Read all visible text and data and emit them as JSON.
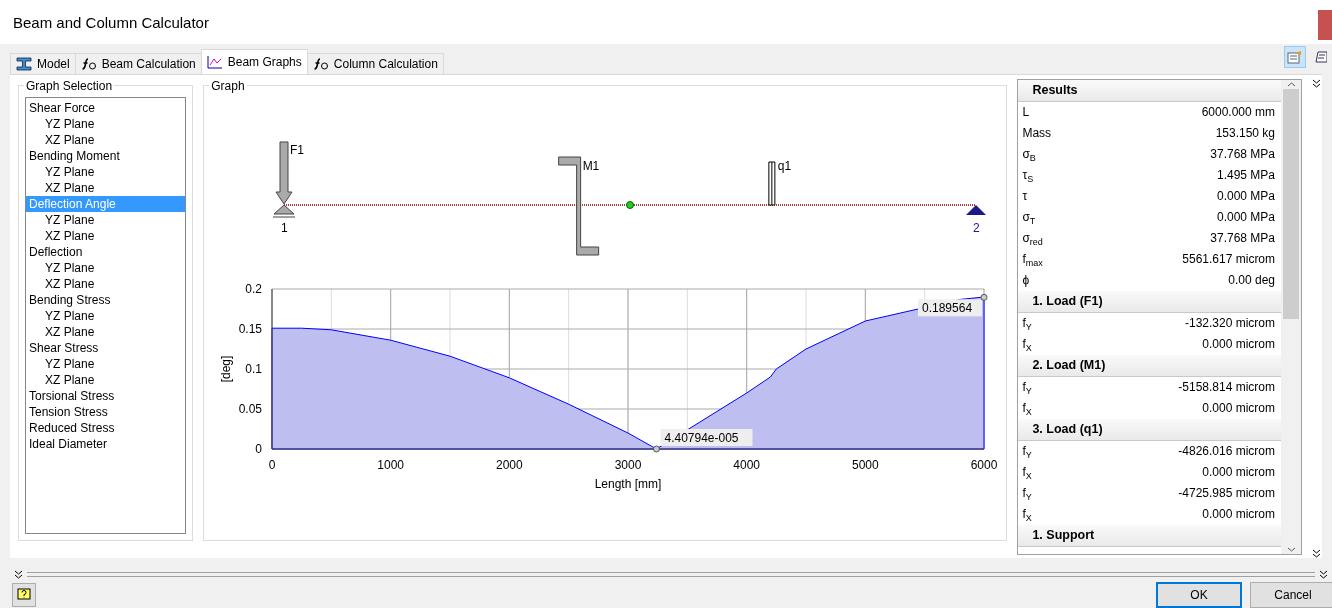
{
  "window": {
    "title": "Beam and Column Calculator"
  },
  "tabs": [
    {
      "label": "Model",
      "kind": "model",
      "selected": false
    },
    {
      "label": "Beam Calculation",
      "kind": "calc",
      "selected": false
    },
    {
      "label": "Beam Graphs",
      "kind": "graph",
      "selected": true
    },
    {
      "label": "Column Calculation",
      "kind": "calc",
      "selected": false
    }
  ],
  "graph_selection": {
    "title": "Graph Selection",
    "items": [
      {
        "label": "Shear Force",
        "selected": false,
        "children": [
          {
            "label": "YZ Plane",
            "selected": false
          },
          {
            "label": "XZ Plane",
            "selected": false
          }
        ]
      },
      {
        "label": "Bending Moment",
        "selected": false,
        "children": [
          {
            "label": "YZ Plane",
            "selected": false
          },
          {
            "label": "XZ Plane",
            "selected": false
          }
        ]
      },
      {
        "label": "Deflection Angle",
        "selected": true,
        "children": [
          {
            "label": "YZ Plane",
            "selected": false
          },
          {
            "label": "XZ Plane",
            "selected": false
          }
        ]
      },
      {
        "label": "Deflection",
        "selected": false,
        "children": [
          {
            "label": "YZ Plane",
            "selected": false
          },
          {
            "label": "XZ Plane",
            "selected": false
          }
        ]
      },
      {
        "label": "Bending Stress",
        "selected": false,
        "children": [
          {
            "label": "YZ Plane",
            "selected": false
          },
          {
            "label": "XZ Plane",
            "selected": false
          }
        ]
      },
      {
        "label": "Shear Stress",
        "selected": false,
        "children": [
          {
            "label": "YZ Plane",
            "selected": false
          },
          {
            "label": "XZ Plane",
            "selected": false
          }
        ]
      },
      {
        "label": "Torsional Stress",
        "selected": false
      },
      {
        "label": "Tension Stress",
        "selected": false
      },
      {
        "label": "Reduced Stress",
        "selected": false
      },
      {
        "label": "Ideal Diameter",
        "selected": false
      }
    ]
  },
  "graph": {
    "title": "Graph",
    "beam": {
      "loads": [
        {
          "kind": "force",
          "label": "F1"
        },
        {
          "kind": "moment",
          "label": "M1"
        },
        {
          "kind": "distributed",
          "label": "q1"
        }
      ],
      "supports": [
        {
          "kind": "fixed",
          "label": "1"
        },
        {
          "kind": "free",
          "label": "2"
        }
      ]
    },
    "chart_data": {
      "type": "area",
      "xlabel": "Length [mm]",
      "ylabel": "[deg]",
      "grid": true,
      "x": [
        0,
        250,
        500,
        1000,
        1500,
        2000,
        2500,
        3000,
        3240,
        4000,
        4200,
        4250,
        4500,
        5000,
        5800,
        6000
      ],
      "series": [
        {
          "color": "#0000ff",
          "values": [
            0.151,
            0.151,
            0.149,
            0.136,
            0.116,
            0.089,
            0.056,
            0.02,
            0,
            0.07,
            0.09,
            0.1,
            0.125,
            0.16,
            0.187,
            0.19
          ]
        }
      ],
      "xlim": [
        0,
        6000
      ],
      "ylim": [
        0,
        0.2
      ],
      "xticks": [
        0,
        1000,
        2000,
        3000,
        4000,
        5000,
        6000
      ],
      "yticks": [
        0,
        0.05,
        0.1,
        0.15,
        0.2
      ],
      "annotations": [
        {
          "x": 3240,
          "y": 0,
          "text": "4.40794e-005"
        },
        {
          "x": 6000,
          "y": 0.189564,
          "text": "0.189564"
        }
      ]
    }
  },
  "results": {
    "title": "Results",
    "sections": [
      {
        "rows": [
          {
            "name": "L",
            "value": "6000.000 mm"
          },
          {
            "name": "Mass",
            "value": "153.150 kg"
          },
          {
            "name": "σ$_{B}$",
            "value": "37.768 MPa"
          },
          {
            "name": "τ$_{S}$",
            "value": "1.495 MPa"
          },
          {
            "name": "τ",
            "value": "0.000 MPa"
          },
          {
            "name": "σ$_{T}$",
            "value": "0.000 MPa"
          },
          {
            "name": "σ$_{red}$",
            "value": "37.768 MPa"
          },
          {
            "name": "f$_{max}$",
            "value": "5561.617 microm"
          },
          {
            "name": "ϕ",
            "value": "0.00 deg"
          }
        ]
      },
      {
        "title": "1. Load (F1)",
        "rows": [
          {
            "name": "f$_{Y}$",
            "value": "-132.320 microm"
          },
          {
            "name": "f$_{X}$",
            "value": "0.000 microm"
          }
        ]
      },
      {
        "title": "2. Load (M1)",
        "rows": [
          {
            "name": "f$_{Y}$",
            "value": "-5158.814 microm"
          },
          {
            "name": "f$_{X}$",
            "value": "0.000 microm"
          }
        ]
      },
      {
        "title": "3. Load (q1)",
        "rows": [
          {
            "name": "f$_{Y}$",
            "value": "-4826.016 microm"
          },
          {
            "name": "f$_{X}$",
            "value": "0.000 microm"
          },
          {
            "name": "f$_{Y}$",
            "value": "-4725.985 microm"
          },
          {
            "name": "f$_{X}$",
            "value": "0.000 microm"
          }
        ]
      },
      {
        "title": "1. Support"
      }
    ]
  },
  "buttons": [
    {
      "label": "OK",
      "kind": "default"
    },
    {
      "label": "Cancel",
      "kind": "normal"
    }
  ]
}
